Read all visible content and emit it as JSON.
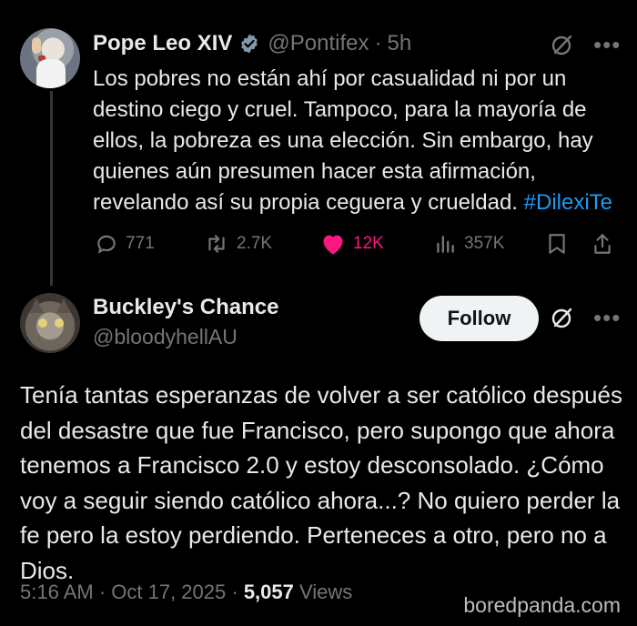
{
  "tweet1": {
    "display_name": "Pope Leo XIV",
    "handle": "@Pontifex",
    "separator": "·",
    "time": "5h",
    "text": "Los pobres no están ahí por casualidad ni por un destino ciego y cruel. Tampoco, para la mayoría de ellos, la pobreza es una elección. Sin embargo, hay quienes aún presumen hacer esta afirmación, revelando así su propia ceguera y crueldad.",
    "hashtag": "#DilexiTe",
    "replies": "771",
    "reposts": "2.7K",
    "likes": "12K",
    "views": "357K",
    "more_icon": "•••"
  },
  "tweet2": {
    "display_name": "Buckley's Chance",
    "handle": "@bloodyhellAU",
    "follow_label": "Follow",
    "more_icon": "•••",
    "text": "Tenía tantas esperanzas de volver a ser católico después del desastre que fue Francisco, pero supongo que ahora tenemos a Francisco 2.0 y estoy desconsolado. ¿Cómo voy a seguir siendo católico ahora...? No quiero perder la fe pero la estoy perdiendo. Perteneces a otro, pero no a Dios.",
    "timestamp": "5:16 AM · Oct 17, 2025 ·",
    "views_count": "5,057",
    "views_label": "Views"
  },
  "watermark": "boredpanda.com",
  "colors": {
    "background": "#000000",
    "text": "#e7e9ea",
    "muted": "#71767b",
    "link": "#1d9bf0",
    "like": "#f91880",
    "verified": "#829aab"
  }
}
